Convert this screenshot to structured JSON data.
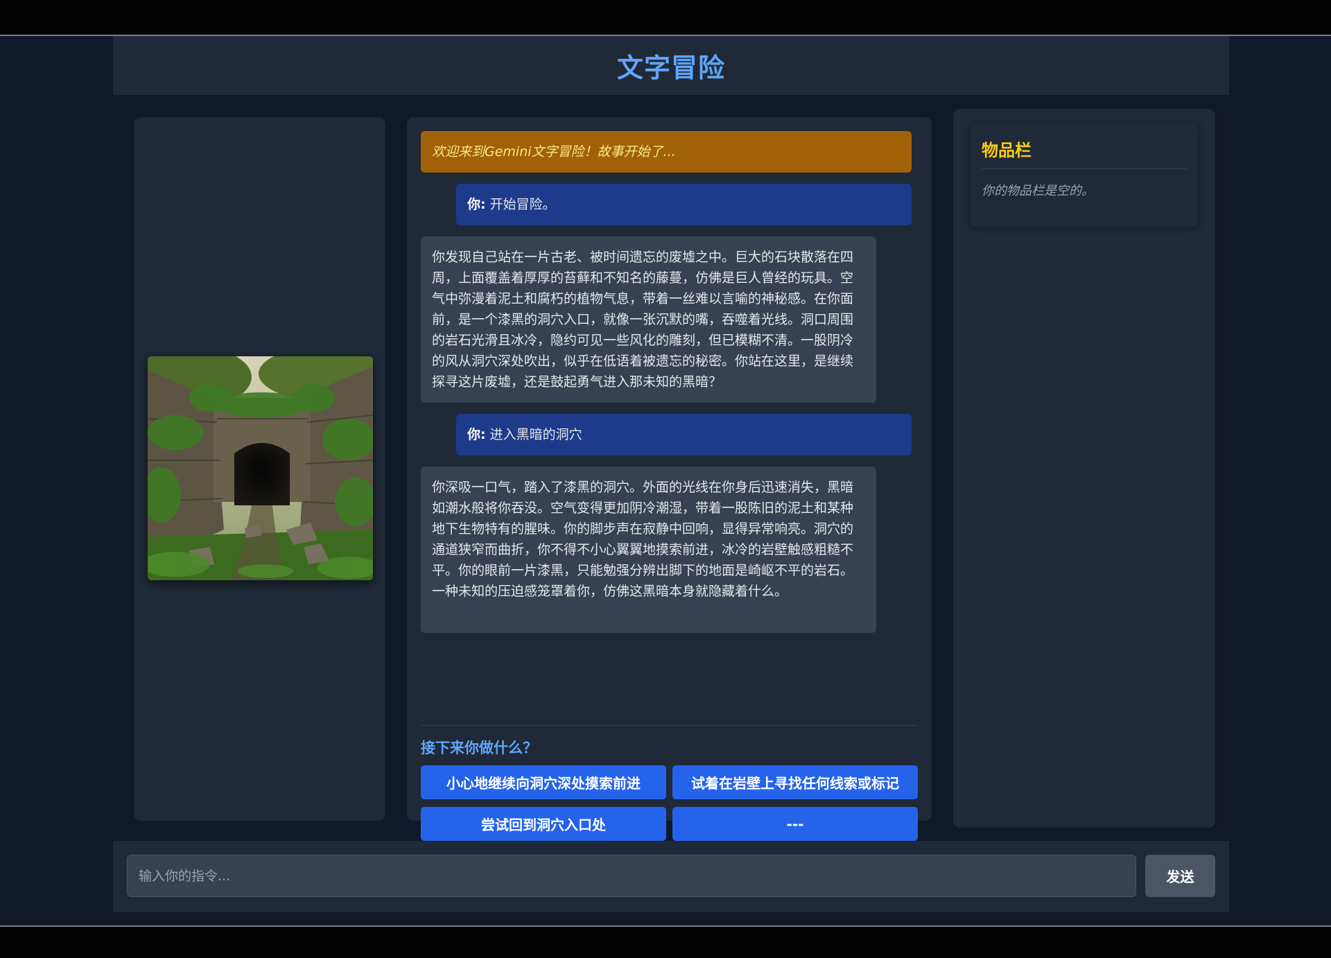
{
  "app": {
    "title": "文字冒险"
  },
  "scene": {
    "image_icon": "cave-ruins-image"
  },
  "chat": {
    "messages": [
      {
        "type": "system",
        "text": "欢迎来到Gemini文字冒险！故事开始了..."
      },
      {
        "type": "user",
        "speaker": "你:",
        "text": " 开始冒险。"
      },
      {
        "type": "ai",
        "text": "你发现自己站在一片古老、被时间遗忘的废墟之中。巨大的石块散落在四周，上面覆盖着厚厚的苔藓和不知名的藤蔓，仿佛是巨人曾经的玩具。空气中弥漫着泥土和腐朽的植物气息，带着一丝难以言喻的神秘感。在你面前，是一个漆黑的洞穴入口，就像一张沉默的嘴，吞噬着光线。洞口周围的岩石光滑且冰冷，隐约可见一些风化的雕刻，但已模糊不清。一股阴冷的风从洞穴深处吹出，似乎在低语着被遗忘的秘密。你站在这里，是继续探寻这片废墟，还是鼓起勇气进入那未知的黑暗？"
      },
      {
        "type": "user",
        "speaker": "你:",
        "text": " 进入黑暗的洞穴"
      },
      {
        "type": "ai",
        "text": "你深吸一口气，踏入了漆黑的洞穴。外面的光线在你身后迅速消失，黑暗如潮水般将你吞没。空气变得更加阴冷潮湿，带着一股陈旧的泥土和某种地下生物特有的腥味。你的脚步声在寂静中回响，显得异常响亮。洞穴的通道狭窄而曲折，你不得不小心翼翼地摸索前进，冰冷的岩壁触感粗糙不平。你的眼前一片漆黑，只能勉强分辨出脚下的地面是崎岖不平的岩石。一种未知的压迫感笼罩着你，仿佛这黑暗本身就隐藏着什么。"
      }
    ]
  },
  "choices": {
    "question": "接下来你做什么？",
    "options": [
      "小心地继续向洞穴深处摸索前进",
      "试着在岩壁上寻找任何线索或标记",
      "尝试回到洞穴入口处",
      "---"
    ]
  },
  "inventory": {
    "title": "物品栏",
    "empty_text": "你的物品栏是空的。"
  },
  "input": {
    "placeholder": "输入你的指令...",
    "value": "",
    "send_label": "发送"
  },
  "colors": {
    "accent": "#60a5fa",
    "system_bg": "#a16207",
    "user_bg": "#1e3a8a",
    "ai_bg": "#374151",
    "choice_bg": "#2563eb",
    "inventory_title": "#facc15"
  }
}
